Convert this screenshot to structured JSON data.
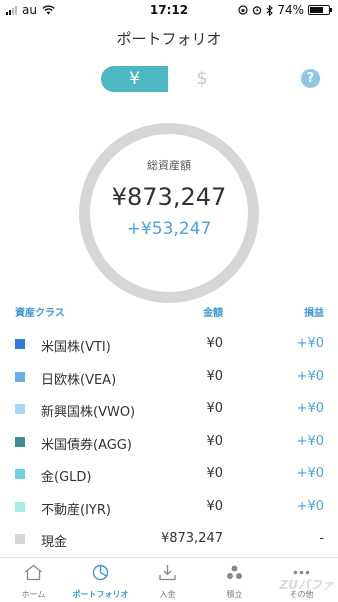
{
  "status_bar": {
    "carrier": "au",
    "time": "17:12",
    "battery_percent": "74%",
    "battery_level": 0.74
  },
  "header": {
    "title": "ポートフォリオ"
  },
  "currency_toggle": {
    "yen": "¥",
    "usd": "$",
    "selected": "yen"
  },
  "help": {
    "label": "?"
  },
  "summary": {
    "label": "総資産額",
    "total": "¥873,247",
    "gain": "+¥53,247"
  },
  "table": {
    "headers": {
      "asset_class": "資産クラス",
      "amount": "金額",
      "profit": "損益"
    },
    "rows": [
      {
        "name": "米国株(VTI)",
        "amount": "¥0",
        "profit": "+¥0",
        "color": "#2f7ed8"
      },
      {
        "name": "日欧株(VEA)",
        "amount": "¥0",
        "profit": "+¥0",
        "color": "#6aaee8"
      },
      {
        "name": "新興国株(VWO)",
        "amount": "¥0",
        "profit": "+¥0",
        "color": "#a9d8f5"
      },
      {
        "name": "米国債券(AGG)",
        "amount": "¥0",
        "profit": "+¥0",
        "color": "#3e8e98"
      },
      {
        "name": "金(GLD)",
        "amount": "¥0",
        "profit": "+¥0",
        "color": "#6fd2de"
      },
      {
        "name": "不動産(IYR)",
        "amount": "¥0",
        "profit": "+¥0",
        "color": "#a8ece8"
      },
      {
        "name": "現金",
        "amount": "¥873,247",
        "profit": "-",
        "color": "#d6d6d6"
      }
    ]
  },
  "tabs": [
    {
      "label": "ホーム",
      "icon": "home-icon"
    },
    {
      "label": "ポートフォリオ",
      "icon": "portfolio-icon",
      "active": true
    },
    {
      "label": "入金",
      "icon": "deposit-icon"
    },
    {
      "label": "積立",
      "icon": "savings-icon"
    },
    {
      "label": "その他",
      "icon": "more-icon"
    }
  ],
  "watermark": "ZUバファ",
  "colors": {
    "accent": "#4db8c2",
    "link": "#3d9ad6",
    "gain": "#4aa3df",
    "ring": "#d6d6d6"
  }
}
